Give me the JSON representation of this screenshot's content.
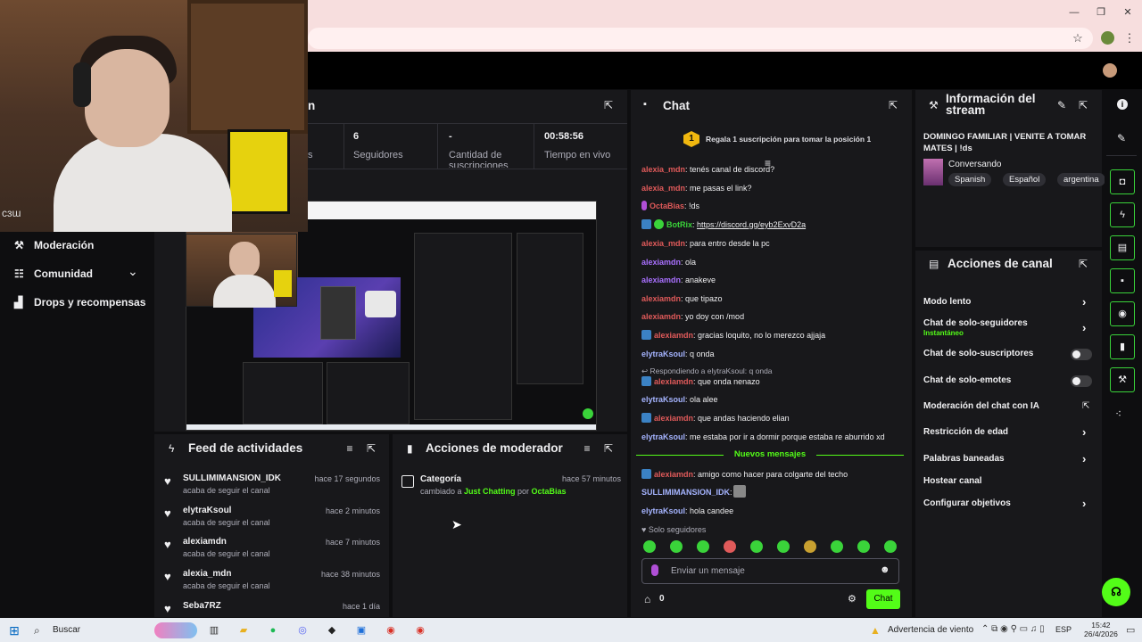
{
  "browser": {
    "min": "—",
    "restore": "❐",
    "close": "✕",
    "star": "☆",
    "menu": "⋮"
  },
  "webcam": {
    "overlay_text": "ᴄɜɯ"
  },
  "sidebar": {
    "items": [
      {
        "label": "Moderación",
        "icon": "⚒"
      },
      {
        "label": "Comunidad",
        "icon": "☷"
      },
      {
        "label": "Drops y recompensas",
        "icon": "▟"
      }
    ],
    "chevron": "⌄"
  },
  "stats": {
    "title_fragment": "n",
    "items": [
      {
        "value": "",
        "label": "s"
      },
      {
        "value": "6",
        "label": "Seguidores"
      },
      {
        "value": "-",
        "label": "Cantidad de suscripciones"
      },
      {
        "value": "00:58:56",
        "label": "Tiempo en vivo"
      }
    ]
  },
  "chat": {
    "title": "Chat",
    "icon": "💬",
    "pin_rank": "1",
    "pin_text": "Regala 1 suscripción para tomar la posición 1",
    "messages": [
      {
        "user": "alexia_mdn",
        "text": ": tenés canal de discord?",
        "color": "#e05a5a",
        "badge": ""
      },
      {
        "user": "alexia_mdn",
        "text": ": me pasas el link?",
        "color": "#e05a5a",
        "badge": ""
      },
      {
        "user": "OctaBias",
        "text": ": !ds",
        "color": "#e05a5a",
        "badge": "mic"
      },
      {
        "user": "BotRix",
        "text": ": ",
        "link": "https://discord.gg/eyb2ExvD2a",
        "color": "#3ad33a",
        "badge": "bot"
      },
      {
        "user": "alexia_mdn",
        "text": ": para entro desde la pc",
        "color": "#e05a5a",
        "badge": ""
      },
      {
        "user": "alexiamdn",
        "text": ": ola",
        "color": "#a970ff",
        "badge": ""
      },
      {
        "user": "alexiamdn",
        "text": ": anakeve",
        "color": "#a970ff",
        "badge": ""
      },
      {
        "user": "alexiamdn",
        "text": ": que tipazo",
        "color": "#e05a5a",
        "badge": ""
      },
      {
        "user": "alexiamdn",
        "text": ": yo doy con /mod",
        "color": "#e05a5a",
        "badge": ""
      },
      {
        "user": "alexiamdn",
        "text": ": gracias loquito, no lo merezco ajjaja",
        "color": "#e05a5a",
        "badge": "mod"
      },
      {
        "user": "elytraKsoul",
        "text": ": q onda",
        "color": "#a5b4ff",
        "badge": ""
      }
    ],
    "reply_text": "Respondiendo a elytraKsoul: q onda",
    "messages2": [
      {
        "user": "alexiamdn",
        "text": ": que onda nenazo",
        "color": "#e05a5a",
        "badge": "mod"
      },
      {
        "user": "elytraKsoul",
        "text": ": ola alee",
        "color": "#a5b4ff",
        "badge": ""
      },
      {
        "user": "alexiamdn",
        "text": ": que andas haciendo elian",
        "color": "#e05a5a",
        "badge": "mod"
      },
      {
        "user": "elytraKsoul",
        "text": ": me estaba por ir a dormir porque estaba re aburrido xd",
        "color": "#a5b4ff",
        "badge": ""
      }
    ],
    "new_messages": "Nuevos mensajes",
    "messages3": [
      {
        "user": "alexiamdn",
        "text": ": amigo como hacer para colgarte del techo",
        "color": "#e05a5a",
        "badge": "mod"
      },
      {
        "user": "SULLIMIMANSION_IDK",
        "text": ":",
        "color": "#a5b4ff",
        "badge": ""
      },
      {
        "user": "elytraKsoul",
        "text": ": hola candee",
        "color": "#a5b4ff",
        "badge": ""
      }
    ],
    "followers_only": "Solo seguidores",
    "input_placeholder": "Enviar un mensaje",
    "count": "0",
    "send": "Chat"
  },
  "stream_info": {
    "title": "Información del stream",
    "stream_title": "DOMINGO FAMILIAR | VENITE A TOMAR MATES | !ds",
    "category": "Conversando",
    "tags": [
      "Spanish",
      "Español",
      "argentina"
    ]
  },
  "channel_actions": {
    "title": "Acciones de canal",
    "items": [
      {
        "label": "Modo lento",
        "control": "chevron"
      },
      {
        "label": "Chat de solo-seguidores",
        "sub": "Instantáneo",
        "control": "chevron"
      },
      {
        "label": "Chat de solo-suscriptores",
        "control": "toggle"
      },
      {
        "label": "Chat de solo-emotes",
        "control": "toggle"
      },
      {
        "label": "Moderación del chat con IA",
        "control": "external"
      },
      {
        "label": "Restricción de edad",
        "control": "chevron"
      },
      {
        "label": "Palabras baneadas",
        "control": "chevron"
      },
      {
        "label": "Hostear canal",
        "control": "none"
      },
      {
        "label": "Configurar objetivos",
        "control": "chevron"
      }
    ]
  },
  "feed": {
    "title": "Feed de actividades",
    "items": [
      {
        "name": "SULLIMIMANSION_IDK",
        "sub": "acaba de seguir el canal",
        "time": "hace 17 segundos"
      },
      {
        "name": "elytraKsoul",
        "sub": "acaba de seguir el canal",
        "time": "hace 2 minutos"
      },
      {
        "name": "alexiamdn",
        "sub": "acaba de seguir el canal",
        "time": "hace 7 minutos"
      },
      {
        "name": "alexia_mdn",
        "sub": "acaba de seguir el canal",
        "time": "hace 38 minutos"
      },
      {
        "name": "Seba7RZ",
        "sub": "",
        "time": "hace 1 día"
      }
    ]
  },
  "mod_actions": {
    "title": "Acciones de moderador",
    "item": {
      "title": "Categoría",
      "time": "hace 57 minutos",
      "prefix": "cambiado a ",
      "value": "Just Chatting",
      "by": " por ",
      "user": "OctaBias"
    }
  },
  "taskbar": {
    "search": "Buscar",
    "weather": "Advertencia de viento",
    "lang": "ESP",
    "time": "15:42",
    "date": "26/4/2026"
  }
}
